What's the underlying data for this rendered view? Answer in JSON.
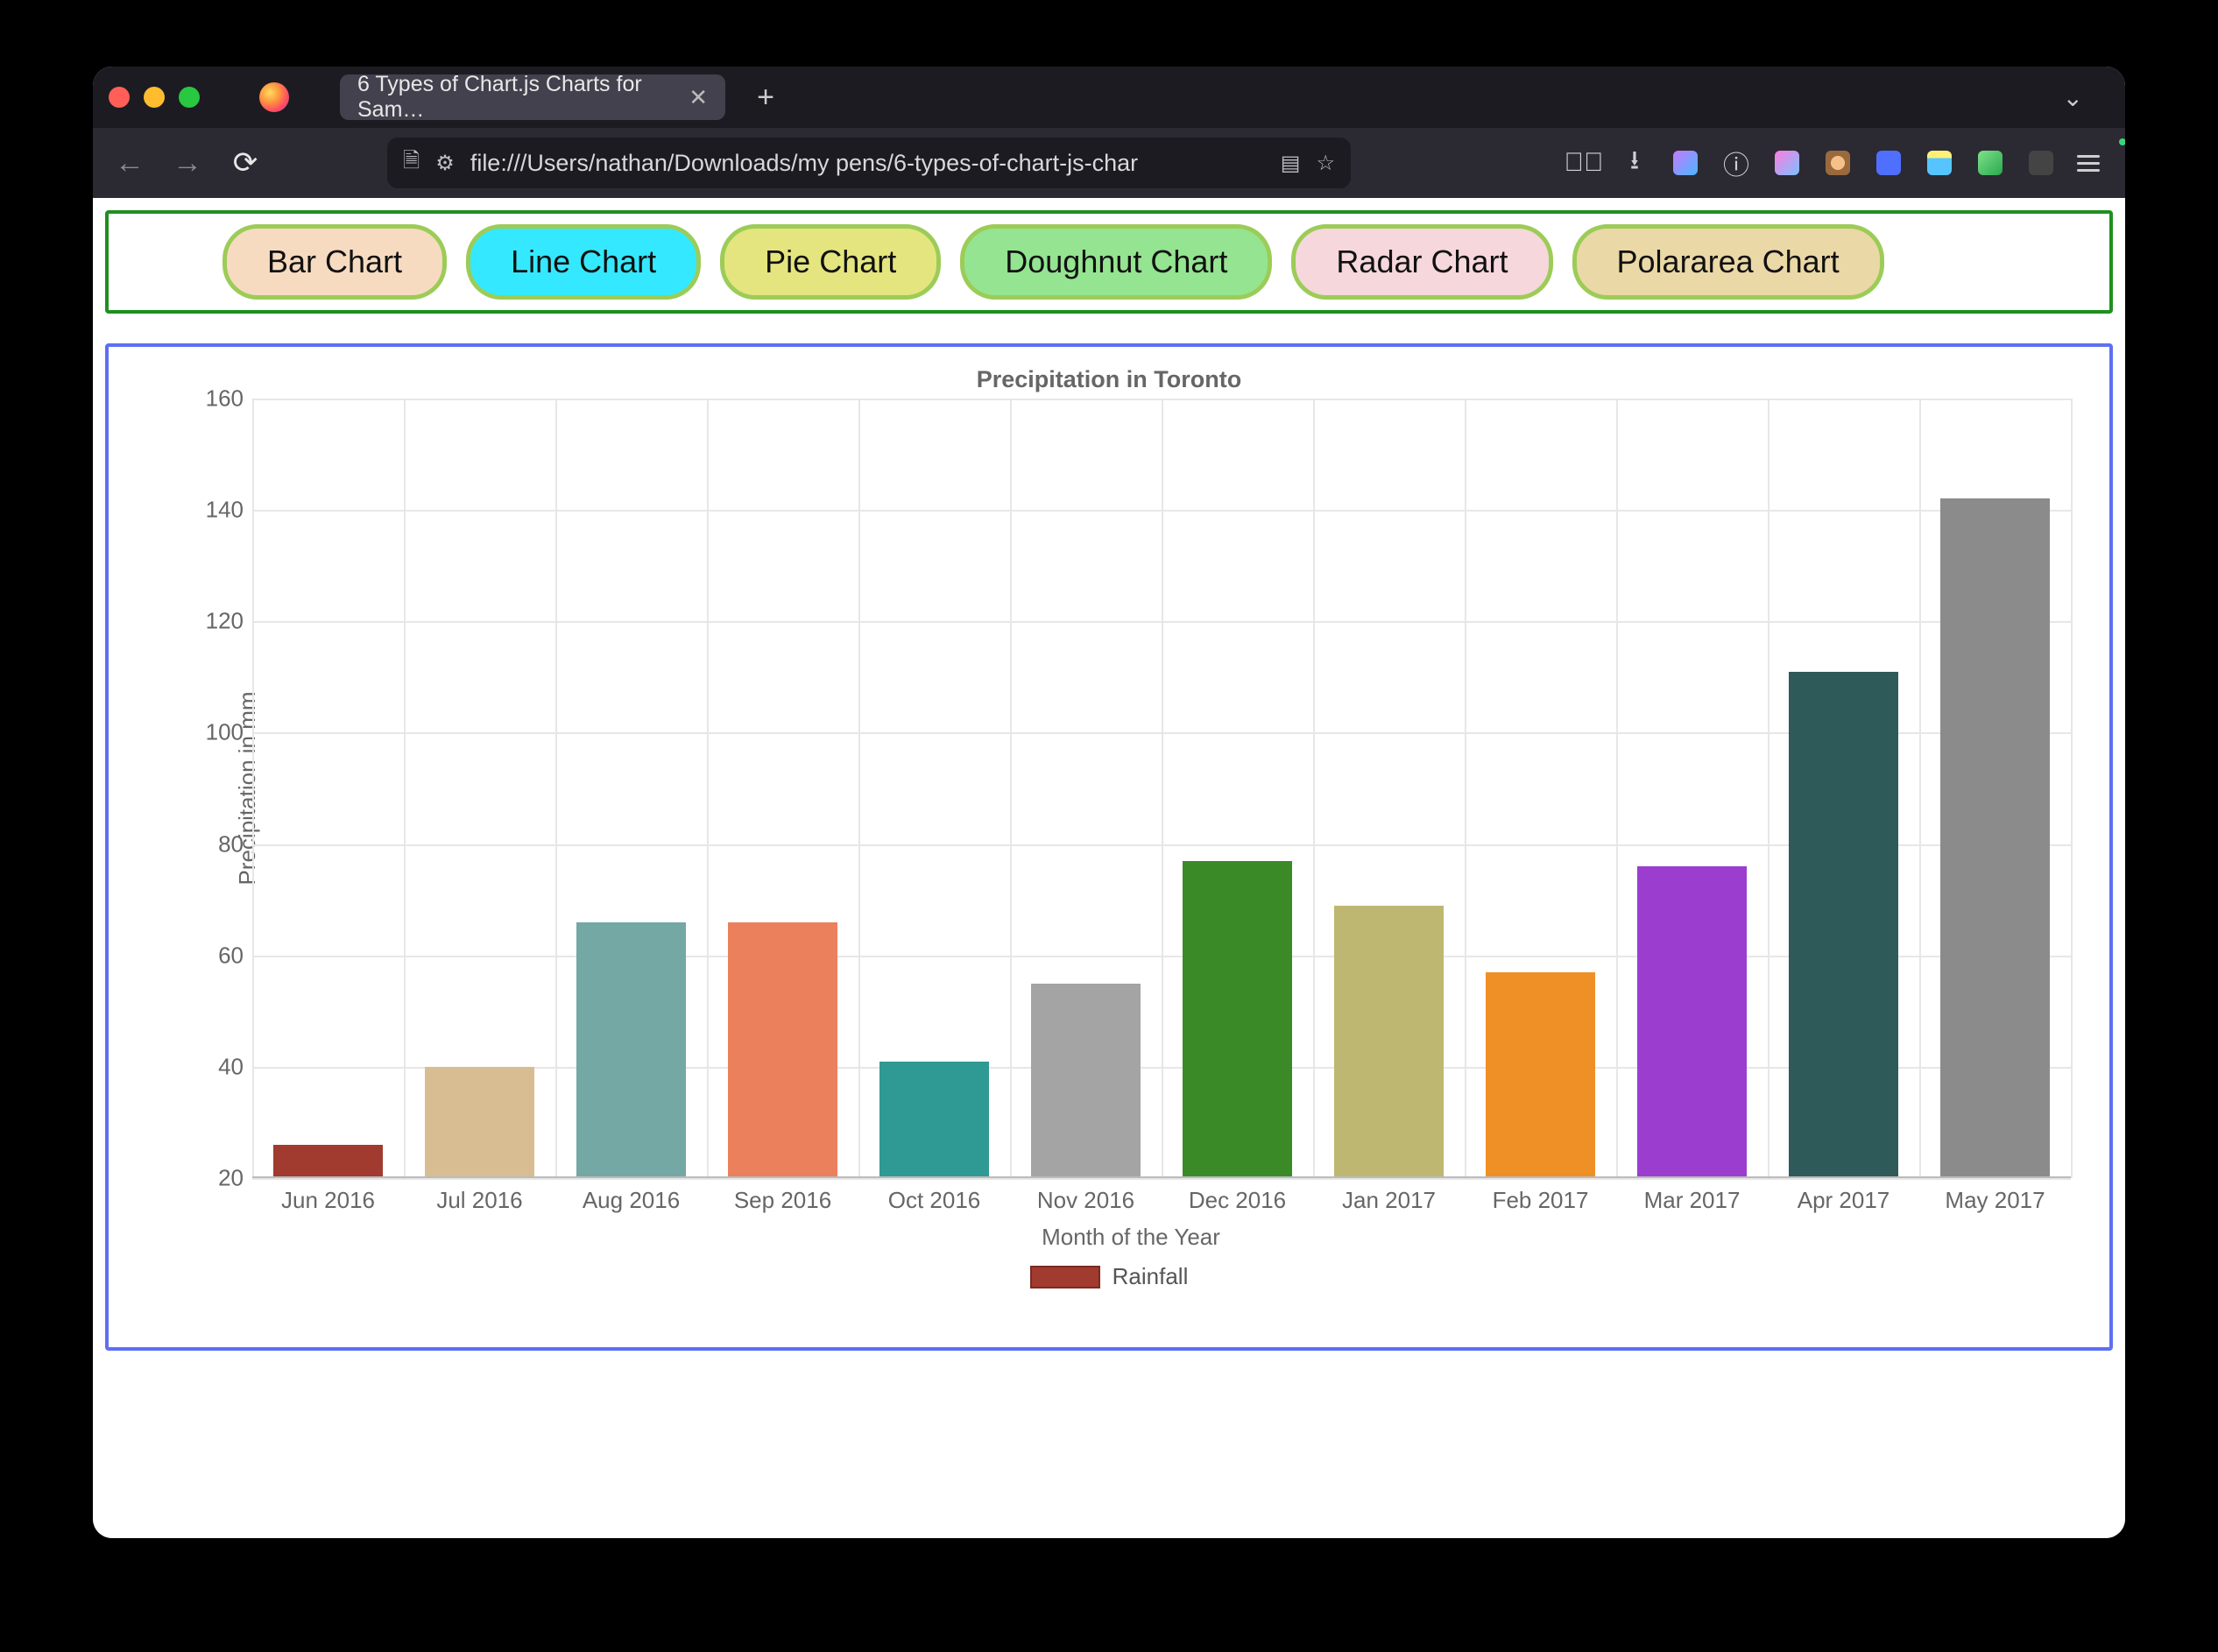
{
  "browser": {
    "tab_title": "6 Types of Chart.js Charts for Sam…",
    "url": "file:///Users/nathan/Downloads/my pens/6-types-of-chart-js-char"
  },
  "buttons": {
    "bar": "Bar Chart",
    "line": "Line Chart",
    "pie": "Pie Chart",
    "doughnut": "Doughnut Chart",
    "radar": "Radar Chart",
    "polar": "Polararea Chart"
  },
  "chart_data": {
    "type": "bar",
    "title": "Precipitation in Toronto",
    "xlabel": "Month of the Year",
    "ylabel": "Precipitation in mm",
    "legend": "Rainfall",
    "ylim": [
      20,
      160
    ],
    "yticks": [
      20,
      40,
      60,
      80,
      100,
      120,
      140,
      160
    ],
    "categories": [
      "Jun 2016",
      "Jul 2016",
      "Aug 2016",
      "Sep 2016",
      "Oct 2016",
      "Nov 2016",
      "Dec 2016",
      "Jan 2017",
      "Feb 2017",
      "Mar 2017",
      "Apr 2017",
      "May 2017"
    ],
    "values": [
      26,
      40,
      66,
      66,
      41,
      55,
      77,
      69,
      57,
      76,
      111,
      142
    ],
    "colors": [
      "#a13a2f",
      "#d9bd92",
      "#73a8a4",
      "#eb805c",
      "#2e9a93",
      "#a4a4a4",
      "#3b8a28",
      "#beb771",
      "#ee9026",
      "#9b3ed0",
      "#2f5a5a",
      "#8b8b8b"
    ]
  }
}
